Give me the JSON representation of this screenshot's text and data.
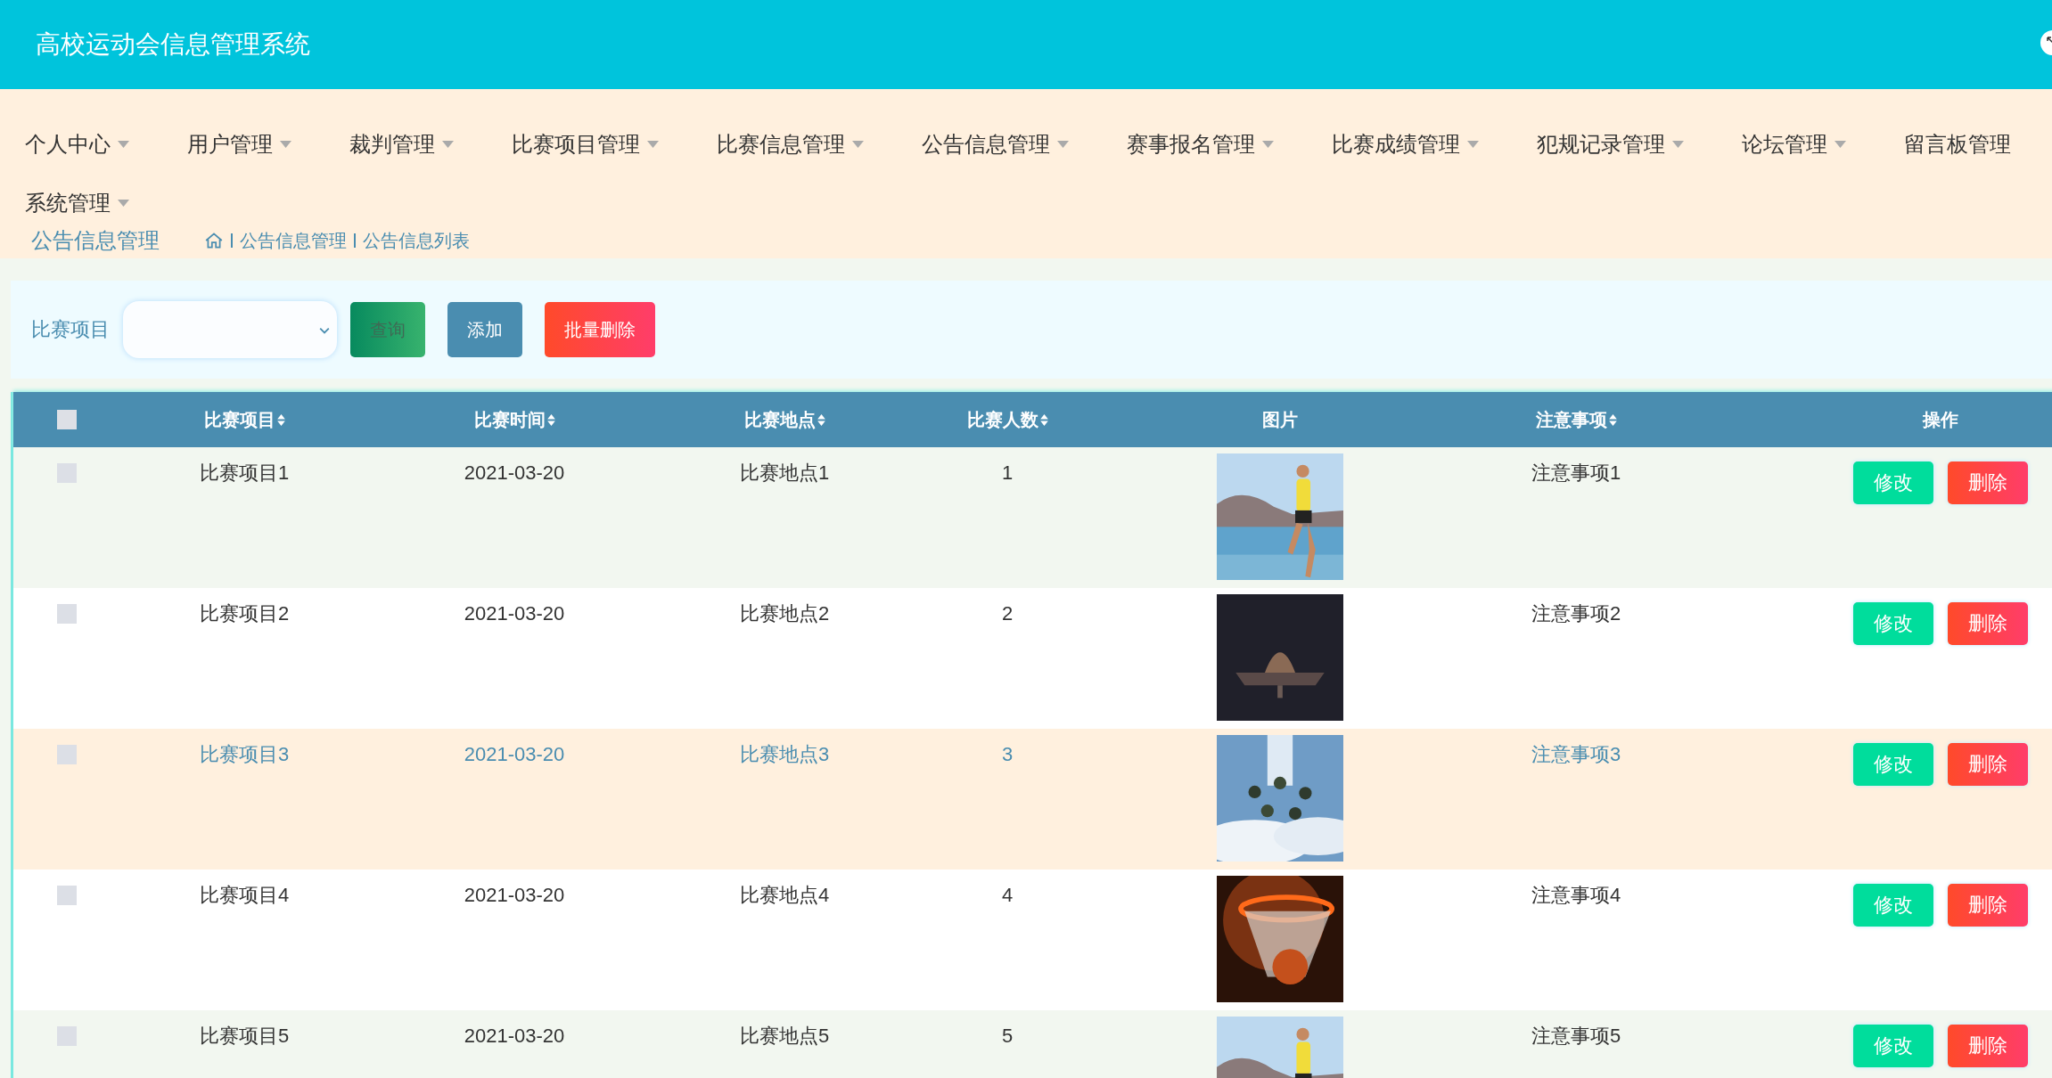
{
  "header": {
    "title": "高校运动会信息管理系统"
  },
  "nav": [
    {
      "label": "个人中心",
      "dropdown": true
    },
    {
      "label": "用户管理",
      "dropdown": true
    },
    {
      "label": "裁判管理",
      "dropdown": true
    },
    {
      "label": "比赛项目管理",
      "dropdown": true
    },
    {
      "label": "比赛信息管理",
      "dropdown": true
    },
    {
      "label": "公告信息管理",
      "dropdown": true
    },
    {
      "label": "赛事报名管理",
      "dropdown": true
    },
    {
      "label": "比赛成绩管理",
      "dropdown": true
    },
    {
      "label": "犯规记录管理",
      "dropdown": true
    },
    {
      "label": "论坛管理",
      "dropdown": true
    },
    {
      "label": "留言板管理",
      "dropdown": false
    },
    {
      "label": "系统管理",
      "dropdown": true
    }
  ],
  "breadcrumb": {
    "title": "公告信息管理",
    "path": [
      "公告信息管理",
      "公告信息列表"
    ]
  },
  "search": {
    "label": "比赛项目",
    "buttons": [
      {
        "label": "查询",
        "kind": "query"
      },
      {
        "label": "添加",
        "kind": "add"
      },
      {
        "label": "批量删除",
        "kind": "delete"
      }
    ]
  },
  "table": {
    "select_all": {
      "checked": false
    },
    "columns": [
      {
        "label": "比赛项目",
        "sortable": true
      },
      {
        "label": "比赛时间",
        "sortable": true
      },
      {
        "label": "比赛地点",
        "sortable": true
      },
      {
        "label": "比赛人数",
        "sortable": true
      },
      {
        "label": "图片",
        "sortable": false
      },
      {
        "label": "注意事项",
        "sortable": true
      },
      {
        "label": "操作",
        "sortable": false
      }
    ],
    "rows": [
      {
        "checked": false,
        "highlighted": false,
        "cells": [
          "比赛项目1",
          "2021-03-20",
          "比赛地点1",
          "1"
        ],
        "note": "注意事项1",
        "actions": [
          "修改",
          "删除"
        ]
      },
      {
        "checked": false,
        "highlighted": false,
        "cells": [
          "比赛项目2",
          "2021-03-20",
          "比赛地点2",
          "2"
        ],
        "note": "注意事项2",
        "actions": [
          "修改",
          "删除"
        ]
      },
      {
        "checked": false,
        "highlighted": true,
        "cells": [
          "比赛项目3",
          "2021-03-20",
          "比赛地点3",
          "3"
        ],
        "note": "注意事项3",
        "actions": [
          "修改",
          "删除"
        ]
      },
      {
        "checked": false,
        "highlighted": false,
        "cells": [
          "比赛项目4",
          "2021-03-20",
          "比赛地点4",
          "4"
        ],
        "note": "注意事项4",
        "actions": [
          "修改",
          "删除"
        ]
      },
      {
        "checked": false,
        "highlighted": false,
        "cells": [
          "比赛项目5",
          "2021-03-20",
          "比赛地点5",
          "5"
        ],
        "note": "注意事项5",
        "actions": [
          "修改",
          "删除"
        ]
      }
    ]
  }
}
